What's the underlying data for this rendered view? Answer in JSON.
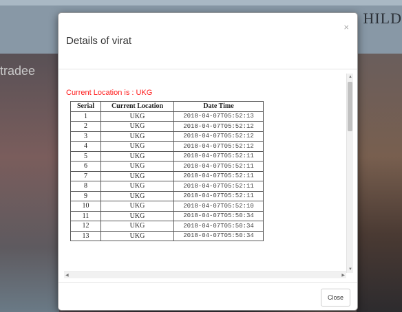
{
  "background": {
    "brand_text": "HILD",
    "side_text": "tradee"
  },
  "modal": {
    "title": "Details of virat",
    "close_x": "×",
    "current_location_line": "Current Location is : UKG",
    "table": {
      "headers": [
        "Serial",
        "Current Location",
        "Date Time"
      ],
      "rows": [
        [
          "1",
          "UKG",
          "2018-04-07T05:52:13"
        ],
        [
          "2",
          "UKG",
          "2018-04-07T05:52:12"
        ],
        [
          "3",
          "UKG",
          "2018-04-07T05:52:12"
        ],
        [
          "4",
          "UKG",
          "2018-04-07T05:52:12"
        ],
        [
          "5",
          "UKG",
          "2018-04-07T05:52:11"
        ],
        [
          "6",
          "UKG",
          "2018-04-07T05:52:11"
        ],
        [
          "7",
          "UKG",
          "2018-04-07T05:52:11"
        ],
        [
          "8",
          "UKG",
          "2018-04-07T05:52:11"
        ],
        [
          "9",
          "UKG",
          "2018-04-07T05:52:11"
        ],
        [
          "10",
          "UKG",
          "2018-04-07T05:52:10"
        ],
        [
          "11",
          "UKG",
          "2018-04-07T05:50:34"
        ],
        [
          "12",
          "UKG",
          "2018-04-07T05:50:34"
        ],
        [
          "13",
          "UKG",
          "2018-04-07T05:50:34"
        ]
      ]
    },
    "close_button_label": "Close"
  },
  "colors": {
    "location_text": "#ff1a1a",
    "overlay": "#6d7f8c"
  },
  "icons": {
    "close": "close-icon",
    "scroll_up": "arrow-up-icon",
    "scroll_down": "arrow-down-icon",
    "scroll_left": "arrow-left-icon",
    "scroll_right": "arrow-right-icon"
  }
}
